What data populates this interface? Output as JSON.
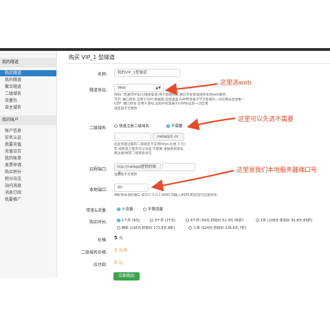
{
  "sidebar": {
    "section1": "我的隧道",
    "items1": [
      "购买隧道",
      "我的隧道",
      "聚合隧道",
      "二级域名",
      "流量包",
      "自主域名"
    ],
    "section2": "我的账户",
    "items2": [
      "账户信息",
      "实名认证",
      "我要充值",
      "充值日志",
      "我的账单",
      "发票申请",
      "购买积分",
      "积分日志",
      "站内消息",
      "消息订阅",
      "我要推广"
    ]
  },
  "page": {
    "title": "购买 VIP_1 型隧道"
  },
  "form": {
    "name_label": "名称:",
    "name_value": "我的VIP_1型隧道",
    "protocol_label": "隧道协议:",
    "protocol_value": "Web",
    "protocol_desc": [
      "Web: 普通的http(s)隧道穿透,用于搭建网站,微信开发等穿透到本地web服务.",
      "TCP: 端口转发 应用于SSH,数据库,远程桌面,GAME等基于TCP连接的一切应用任您想象~",
      "UDP: 端口转发 应用于游戏,远程开机等基于UDP协议的一切应用",
      "选定后不可更改"
    ],
    "domain_label": "二级域名:",
    "domain_opt1": "快速注册二级域名",
    "domain_opt2": "不需要",
    "domain_suffix": ".natapp1.cc",
    "domain_desc": [
      "此处快速注册的二级域名不支持https,价格 3 元/",
      "年.如有其它需求可以点选 不需要 单独购买域名,",
      "再注册/绑定二级域名详见"
    ],
    "remote_label": "远程端口:",
    "remote_placeholder": "tcp://natapp提供的域名:",
    "remote_desc": "选定后不可更改",
    "local_label": "本地端口:",
    "local_value": "80",
    "local_desc": "映射到本地的端口 如127.0.0.1:8080 则输入8080,购买后可任意修改",
    "bandwidth_label": "带宽&流量:",
    "bandwidth_opt1": "小流量",
    "bandwidth_opt2": "不限流量",
    "duration_label": "购买时长:",
    "dur_row1": [
      {
        "label": "1个月 (9元)",
        "on": true
      },
      {
        "label": "3个月 (27元)",
        "on": false
      },
      {
        "label": "6个月 (54元 折扣价 51.3元 95折)",
        "on": false
      },
      {
        "label": "1年 (108元 折扣价 91.8元 85折)",
        "on": false
      }
    ],
    "dur_row2": [
      {
        "label": "两年 (216元 折扣价 172.8元 8折)",
        "on": false
      },
      {
        "label": "三年 (324元 折扣价 226.8元 7折)",
        "on": false
      }
    ],
    "price_label": "价格:",
    "price_value": "5",
    "price_unit": "元",
    "domain_price_label": "二级域名价格:",
    "domain_price_value": "3",
    "domain_price_unit": "元/年",
    "payable_label": "应付款:",
    "payable_value": "5",
    "payable_unit": "元",
    "buy_button": "立即购买"
  },
  "annotations": {
    "a1": "这里选web",
    "a2": "这里可以先选不需要",
    "a3": "这里是我们本地服务器端口号"
  },
  "colors": {
    "accent": "#2d80c6",
    "annotation": "#e64b2b",
    "buy": "#3aa54a"
  }
}
